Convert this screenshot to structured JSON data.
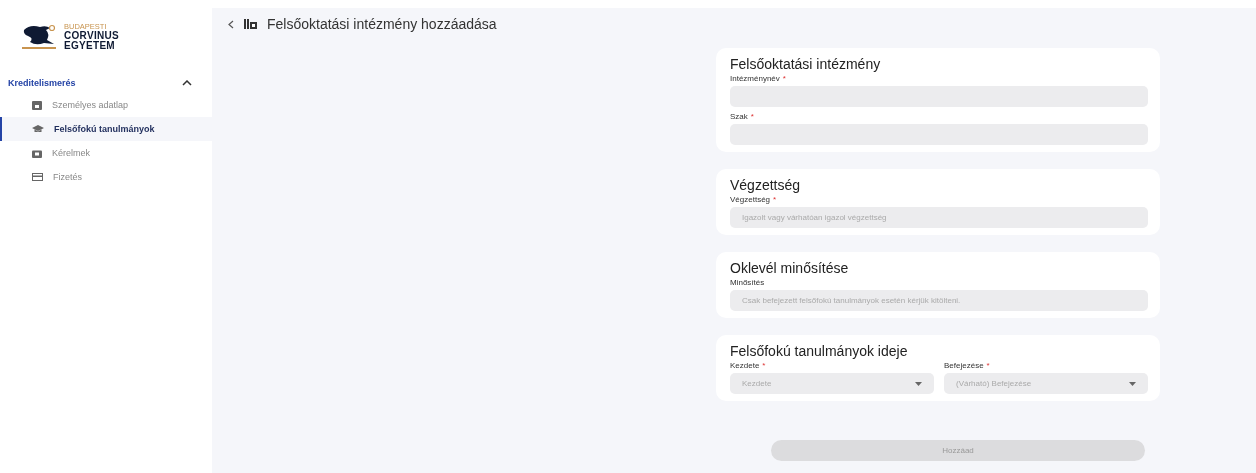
{
  "logo": {
    "lines": [
      "BUDAPESTI",
      "CORVINUS",
      "EGYETEM"
    ]
  },
  "sidebar": {
    "group": {
      "label": "Kreditelismerés",
      "expanded": true
    },
    "items": [
      {
        "label": "Személyes adatlap",
        "selected": false
      },
      {
        "label": "Felsőfokú tanulmányok",
        "selected": true
      },
      {
        "label": "Kérelmek",
        "selected": false
      },
      {
        "label": "Fizetés",
        "selected": false
      }
    ]
  },
  "header": {
    "title": "Felsőoktatási intézmény hozzáadása"
  },
  "sections": [
    {
      "title": "Felsőoktatási intézmény",
      "fields": [
        {
          "kind": "text",
          "label": "Intézménynév",
          "required_mark": "*"
        },
        {
          "kind": "text",
          "label": "Szak",
          "required_mark": "*"
        }
      ]
    },
    {
      "title": "Végzettség",
      "fields": [
        {
          "kind": "text",
          "label": "Végzettség",
          "required_mark": "*",
          "placeholder": "Igazolt vagy várhatóan igazol végzettség"
        }
      ]
    },
    {
      "title": "Oklevél minősítése",
      "fields": [
        {
          "kind": "text",
          "label": "Minősítés",
          "placeholder": "Csak befejezett felsőfokú tanulmányok esetén kérjük kitölteni."
        }
      ]
    },
    {
      "title": "Felsőfokú tanulmányok ideje",
      "fields": [
        {
          "kind": "select",
          "label": "Kezdete",
          "required_mark": "*",
          "placeholder": "Kezdete"
        },
        {
          "kind": "select",
          "label": "Befejezése",
          "required_mark": "*",
          "placeholder": "(Várható) Befejezése"
        }
      ]
    }
  ],
  "submit": {
    "label": "Hozzáad",
    "disabled": true
  }
}
